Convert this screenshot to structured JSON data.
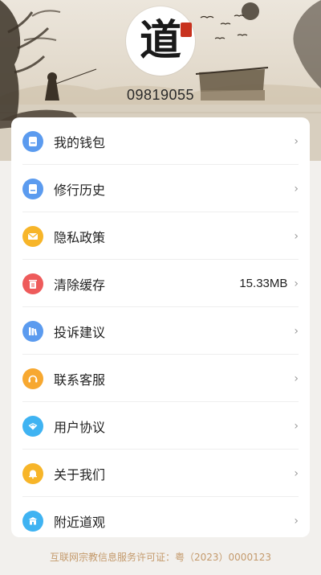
{
  "profile": {
    "avatar_glyph": "道",
    "user_id": "09819055"
  },
  "menu": {
    "items": [
      {
        "label": "我的钱包",
        "icon": "wallet-icon",
        "color": "#5b9bef",
        "value": ""
      },
      {
        "label": "修行历史",
        "icon": "history-icon",
        "color": "#5b9bef",
        "value": ""
      },
      {
        "label": "隐私政策",
        "icon": "mail-icon",
        "color": "#f7b529",
        "value": ""
      },
      {
        "label": "清除缓存",
        "icon": "trash-icon",
        "color": "#ee5b5b",
        "value": "15.33MB"
      },
      {
        "label": "投诉建议",
        "icon": "books-icon",
        "color": "#5b9bef",
        "value": ""
      },
      {
        "label": "联系客服",
        "icon": "headset-icon",
        "color": "#f7a830",
        "value": ""
      },
      {
        "label": "用户协议",
        "icon": "agreement-icon",
        "color": "#3fb3f2",
        "value": ""
      },
      {
        "label": "关于我们",
        "icon": "bell-icon",
        "color": "#f7b529",
        "value": ""
      },
      {
        "label": "附近道观",
        "icon": "temple-icon",
        "color": "#3fb3f2",
        "value": ""
      }
    ],
    "chevron": "›"
  },
  "footer": {
    "license": "互联网宗教信息服务许可证：粤（2023）0000123"
  }
}
